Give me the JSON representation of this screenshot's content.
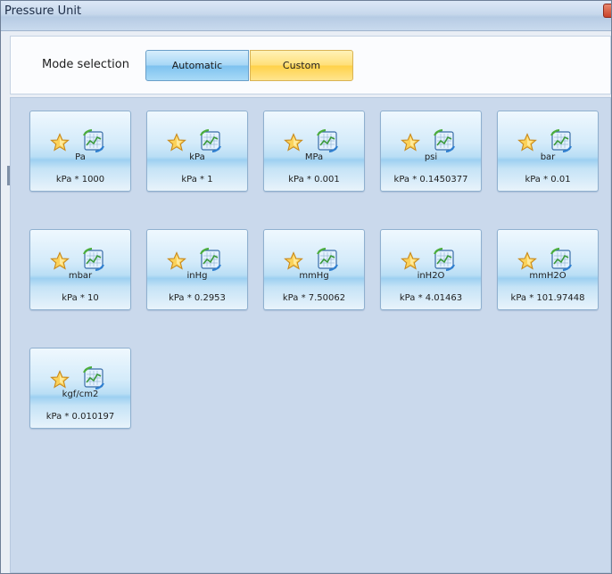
{
  "window": {
    "title": "Pressure Unit"
  },
  "mode": {
    "label": "Mode selection",
    "automatic_label": "Automatic",
    "custom_label": "Custom",
    "selected": "Automatic"
  },
  "units": [
    {
      "name": "Pa",
      "factor": "kPa * 1000"
    },
    {
      "name": "kPa",
      "factor": "kPa * 1"
    },
    {
      "name": "MPa",
      "factor": "kPa * 0.001"
    },
    {
      "name": "psi",
      "factor": "kPa * 0.1450377"
    },
    {
      "name": "bar",
      "factor": "kPa * 0.01"
    },
    {
      "name": "mbar",
      "factor": "kPa * 10"
    },
    {
      "name": "inHg",
      "factor": "kPa * 0.2953"
    },
    {
      "name": "mmHg",
      "factor": "kPa * 7.50062"
    },
    {
      "name": "inH2O",
      "factor": "kPa * 4.01463"
    },
    {
      "name": "mmH2O",
      "factor": "kPa * 101.97448"
    },
    {
      "name": "kgf/cm2",
      "factor": "kPa * 0.010197"
    }
  ],
  "icons": {
    "favorite": "star-icon",
    "chart": "chart-icon"
  },
  "colors": {
    "accent_blue": "#7ec2ef",
    "accent_yellow": "#ffd24a",
    "star": "#f5c242",
    "background": "#cad9ec"
  }
}
